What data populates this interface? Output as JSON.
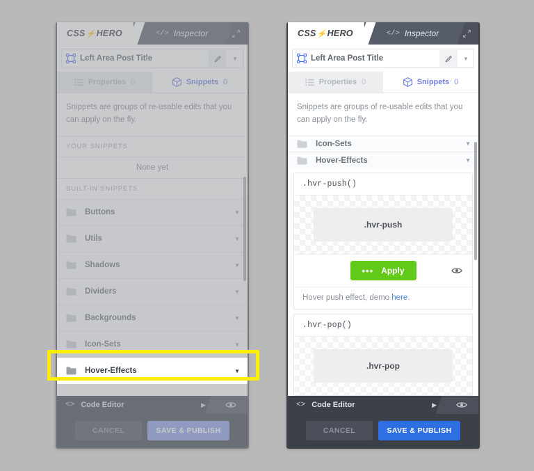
{
  "app": {
    "logo_css": "CSS",
    "logo_bolt": "⚡",
    "logo_hero": "HERO",
    "inspector_tab_code": "</>",
    "inspector_tab_label": "Inspector",
    "expand_icon": "expand-icon"
  },
  "selector": {
    "title": "Left Area Post Title",
    "edit_icon": "pencil-icon",
    "caret_icon": "chevron-down-icon",
    "target_icon": "selection-box-icon"
  },
  "tabs": [
    {
      "label": "Properties",
      "count": "0",
      "icon": "list-icon",
      "active": false
    },
    {
      "label": "Snippets",
      "count": "0",
      "icon": "cube-icon",
      "active": true
    }
  ],
  "intro_text": "Snippets are groups of re-usable edits that you can apply on the fly.",
  "left_panel": {
    "your_snippets_label": "YOUR SNIPPETS",
    "none_yet": "None yet",
    "builtin_label": "BUILT-IN SNIPPETS",
    "folders": [
      {
        "label": "Buttons"
      },
      {
        "label": "Utils"
      },
      {
        "label": "Shadows"
      },
      {
        "label": "Dividers"
      },
      {
        "label": "Backgrounds"
      },
      {
        "label": "Icon-Sets"
      },
      {
        "label": "Hover-Effects"
      }
    ]
  },
  "right_panel": {
    "folders": [
      {
        "label": "Icon-Sets"
      },
      {
        "label": "Hover-Effects"
      }
    ],
    "snippets": [
      {
        "name": ".hvr-push()",
        "preview_label": ".hvr-push",
        "apply_label": "Apply",
        "apply_dots": "•••",
        "eye_icon": "eye-icon",
        "description_prefix": "Hover push effect, demo ",
        "description_link": "here",
        "description_suffix": "."
      },
      {
        "name": ".hvr-pop()",
        "preview_label": ".hvr-pop"
      }
    ]
  },
  "bottom_bar": {
    "code_icon": "<>",
    "code_label": "Code Editor",
    "arrow_icon": "play-arrow-icon",
    "eye_icon": "eye-icon",
    "cancel_label": "CANCEL",
    "save_label": "SAVE & PUBLISH"
  },
  "colors": {
    "accent_blue": "#2f6fe4",
    "apply_green": "#63c919",
    "highlight_yellow": "#ffee00",
    "tab_active_blue": "#6f7fe0",
    "link_blue": "#4a90e2",
    "page_background": "#b9b9ba",
    "chrome_dark": "#3c4049"
  }
}
